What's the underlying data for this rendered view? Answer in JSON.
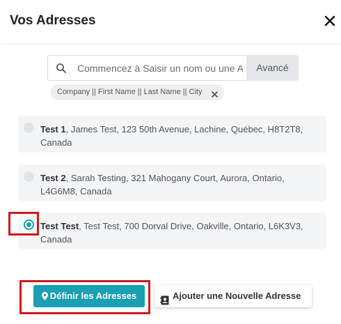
{
  "header": {
    "title": "Vos Adresses"
  },
  "search": {
    "placeholder": "Commencez à Saisir un nom ou une Adresse",
    "advanced_label": "Avancé",
    "filter_chip": "Company || First Name || Last Name || City"
  },
  "addresses": [
    {
      "name": "Test 1",
      "details": ", James Test, 123 50th Avenue, Lachine, Québec, H8T2T8, Canada",
      "selected": false
    },
    {
      "name": "Test 2",
      "details": ", Sarah Testing, 321 Mahogany Court, Aurora, Ontario, L4G6M8, Canada",
      "selected": false
    },
    {
      "name": "Test Test",
      "details": ", Test Test, 700 Dorval Drive, Oakville, Ontario, L6K3V3, Canada",
      "selected": true
    }
  ],
  "actions": {
    "define_label": "Définir les Adresses",
    "add_label": "Ajouter une Nouvelle Adresse"
  },
  "colors": {
    "accent": "#1aa0b2",
    "highlight": "#d11a1a"
  },
  "icons": {
    "close": "close-icon",
    "search": "search-icon",
    "chip_close": "chip-close-icon",
    "pin": "map-marker-icon",
    "address_book": "address-book-icon"
  }
}
